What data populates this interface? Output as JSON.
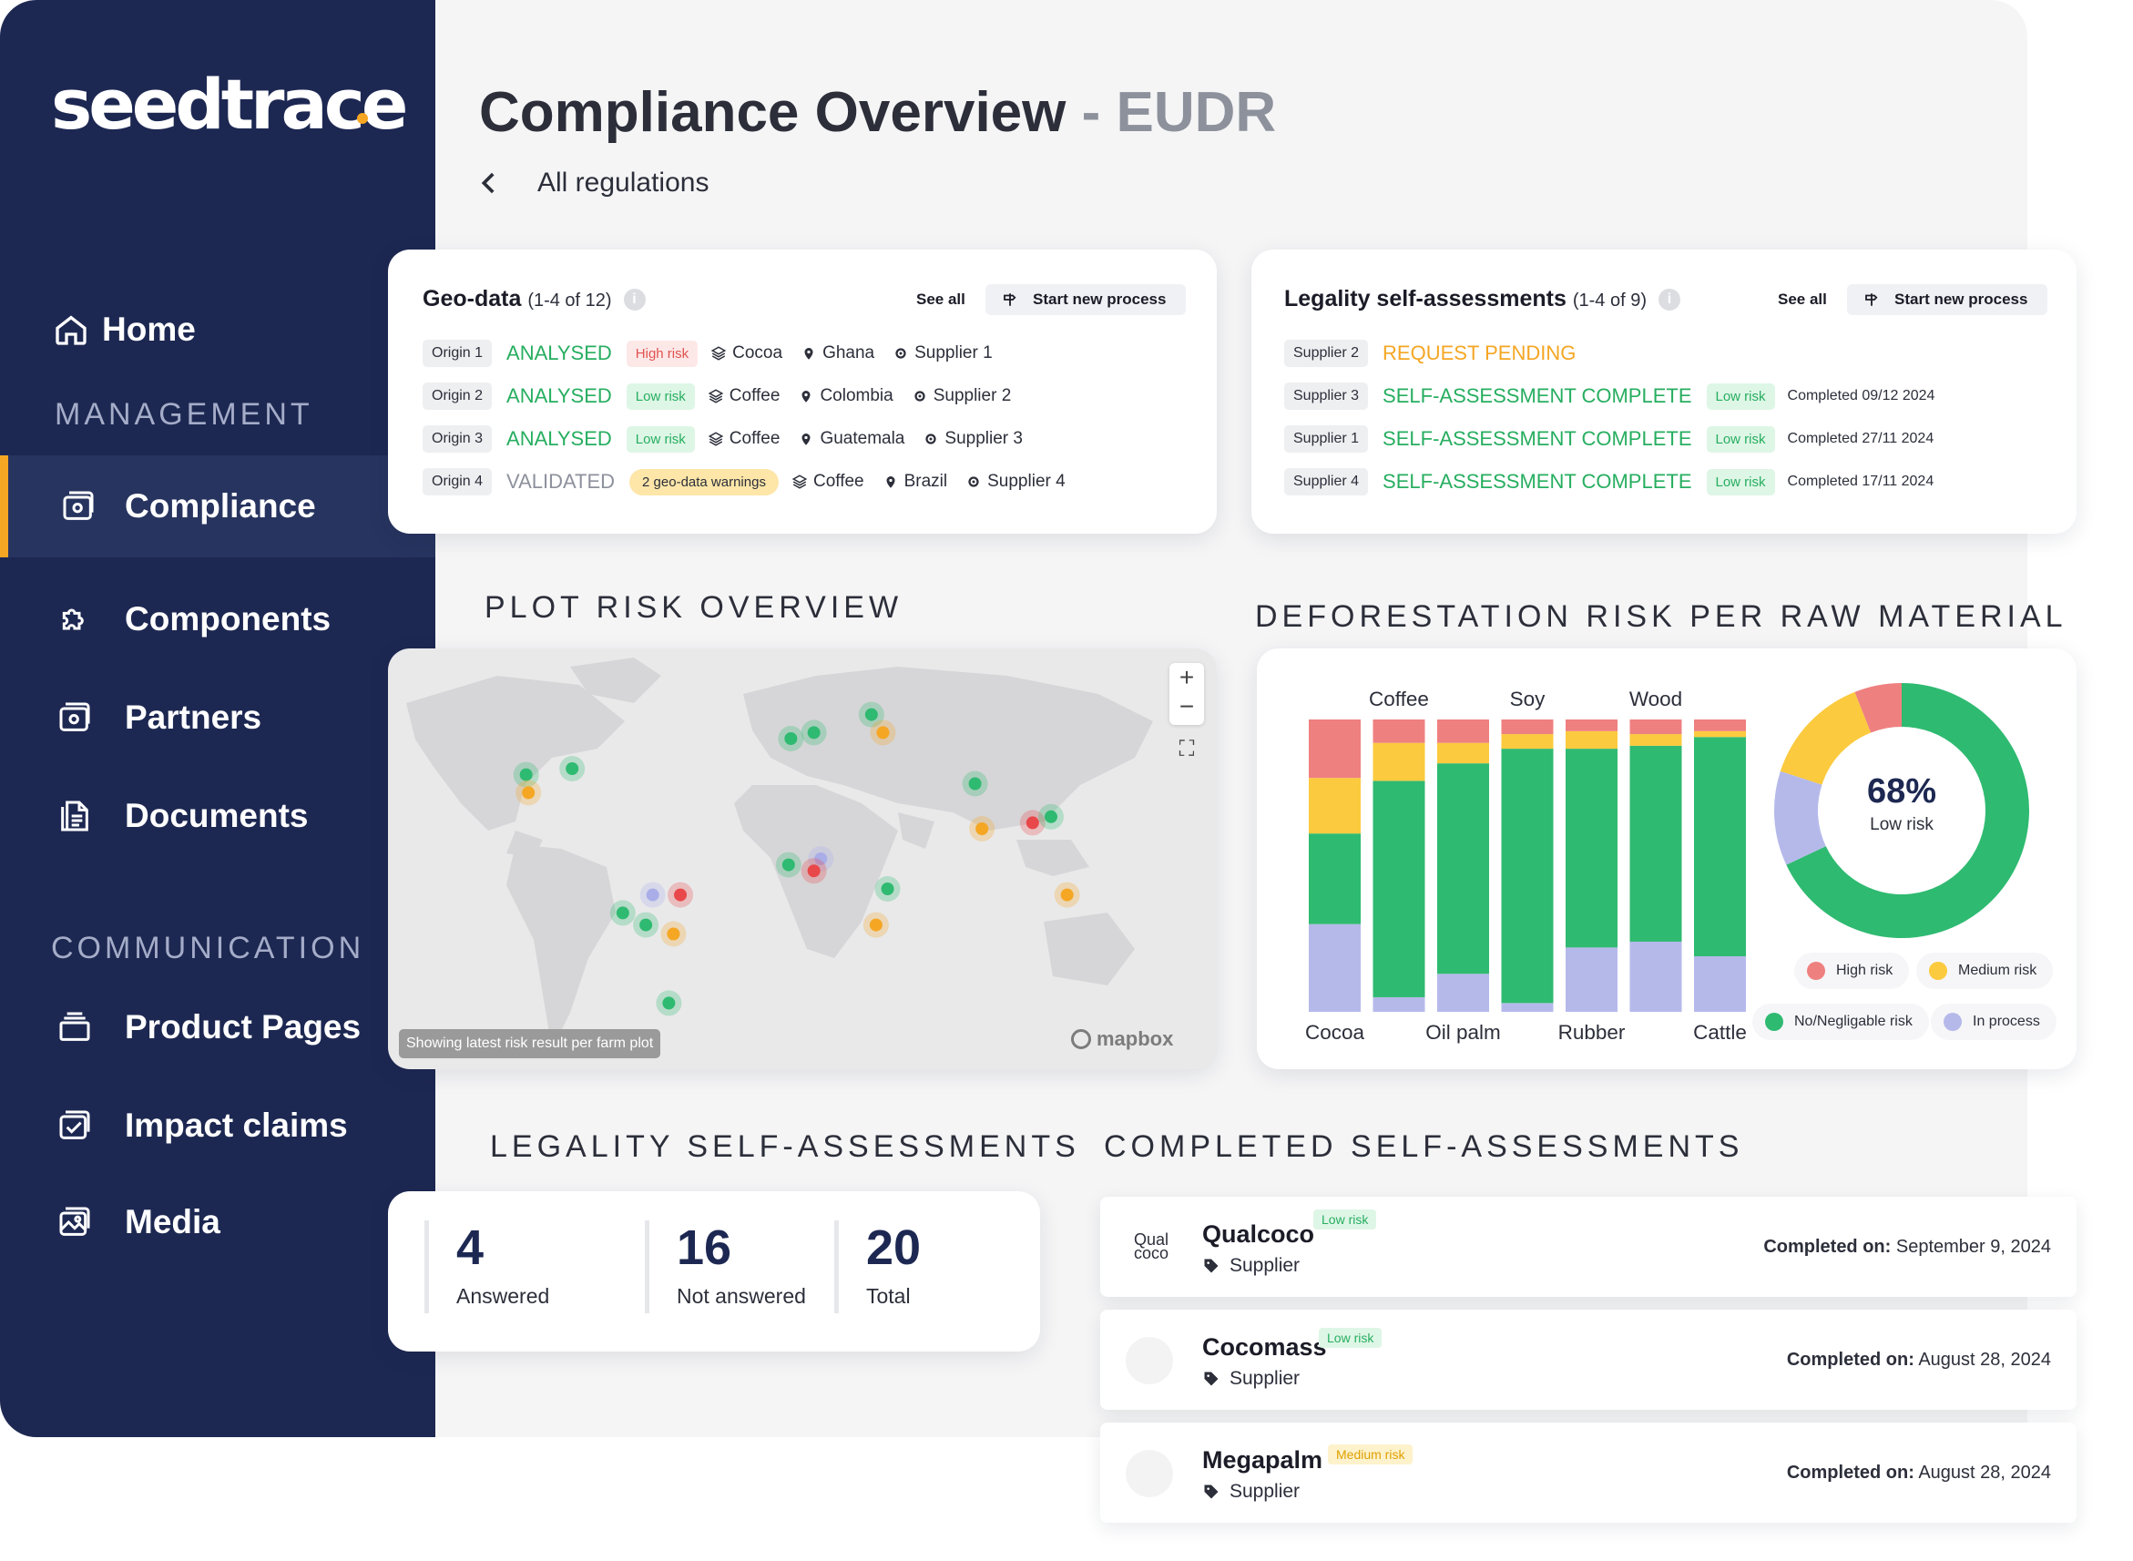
{
  "brand": {
    "logo_text": "seedtrace",
    "accent": "#f5a623",
    "sidebar_bg": "#1d2852"
  },
  "sidebar": {
    "home": "Home",
    "section_management": "MANAGEMENT",
    "items_management": [
      "Compliance",
      "Components",
      "Partners",
      "Documents"
    ],
    "section_communication": "COMMUNICATION",
    "items_communication": [
      "Product Pages",
      "Impact claims",
      "Media"
    ],
    "active": "Compliance"
  },
  "header": {
    "title": "Compliance Overview",
    "title_suffix": "- EUDR",
    "breadcrumb": "All regulations"
  },
  "geo_data": {
    "title": "Geo-data",
    "count": "(1-4 of 12)",
    "see_all": "See all",
    "start_button": "Start new process",
    "rows": [
      {
        "origin": "Origin 1",
        "status": "ANALYSED",
        "badge": "High risk",
        "commodity": "Cocoa",
        "country": "Ghana",
        "supplier": "Supplier 1"
      },
      {
        "origin": "Origin 2",
        "status": "ANALYSED",
        "badge": "Low risk",
        "commodity": "Coffee",
        "country": "Colombia",
        "supplier": "Supplier 2"
      },
      {
        "origin": "Origin 3",
        "status": "ANALYSED",
        "badge": "Low risk",
        "commodity": "Coffee",
        "country": "Guatemala",
        "supplier": "Supplier 3"
      },
      {
        "origin": "Origin 4",
        "status": "VALIDATED",
        "badge": "2 geo-data warnings",
        "commodity": "Coffee",
        "country": "Brazil",
        "supplier": "Supplier 4"
      }
    ]
  },
  "legality": {
    "title": "Legality self-assessments",
    "count": "(1-4 of 9)",
    "see_all": "See all",
    "start_button": "Start new process",
    "rows": [
      {
        "supplier": "Supplier 2",
        "status": "REQUEST PENDING",
        "badge": "",
        "completed": ""
      },
      {
        "supplier": "Supplier 3",
        "status": "SELF-ASSESSMENT COMPLETE",
        "badge": "Low risk",
        "completed": "Completed 09/12 2024"
      },
      {
        "supplier": "Supplier 1",
        "status": "SELF-ASSESSMENT COMPLETE",
        "badge": "Low risk",
        "completed": "Completed 27/11 2024"
      },
      {
        "supplier": "Supplier 4",
        "status": "SELF-ASSESSMENT COMPLETE",
        "badge": "Low risk",
        "completed": "Completed 17/11 2024"
      }
    ]
  },
  "plot_risk": {
    "label": "PLOT RISK OVERVIEW",
    "note": "Showing latest risk result per farm plot",
    "attribution": "mapbox",
    "zoom_in": "+",
    "zoom_out": "−",
    "fullscreen": "⛶"
  },
  "deforestation": {
    "label": "DEFORESTATION RISK PER RAW MATERIAL"
  },
  "chart_data": [
    {
      "type": "bar",
      "stacked": true,
      "categories": [
        "Cocoa",
        "Coffee",
        "Oil palm",
        "Soy",
        "Rubber",
        "Wood",
        "Cattle"
      ],
      "series": [
        {
          "name": "In process",
          "color": "#b5b9ea",
          "values": [
            30,
            5,
            13,
            3,
            22,
            24,
            19
          ]
        },
        {
          "name": "No/Negligable risk",
          "color": "#2fba71",
          "values": [
            31,
            74,
            72,
            87,
            68,
            67,
            75
          ]
        },
        {
          "name": "Medium risk",
          "color": "#fbca3e",
          "values": [
            19,
            13,
            7,
            5,
            6,
            4,
            2
          ]
        },
        {
          "name": "High risk",
          "color": "#ef8080",
          "values": [
            20,
            8,
            8,
            5,
            4,
            5,
            4
          ]
        }
      ],
      "ylim": [
        0,
        100
      ],
      "grid": false
    },
    {
      "type": "pie",
      "donut": true,
      "center_value": "68%",
      "center_label": "Low risk",
      "slices": [
        {
          "name": "No/Negligable risk",
          "value": 68,
          "color": "#2fba71"
        },
        {
          "name": "In process",
          "value": 12,
          "color": "#b5b9ea"
        },
        {
          "name": "Medium risk",
          "value": 14,
          "color": "#fbca3e"
        },
        {
          "name": "High risk",
          "value": 6,
          "color": "#ef8080"
        }
      ],
      "legend": [
        "High risk",
        "Medium risk",
        "No/Negligable risk",
        "In process"
      ]
    }
  ],
  "legality_stats": {
    "label": "LEGALITY SELF-ASSESSMENTS",
    "answered": "4",
    "answered_label": "Answered",
    "not_answered": "16",
    "not_answered_label": "Not answered",
    "total": "20",
    "total_label": "Total"
  },
  "completed": {
    "label": "COMPLETED SELF-ASSESSMENTS",
    "date_prefix": "Completed on:",
    "items": [
      {
        "name": "Qualcoco",
        "type": "Supplier",
        "badge": "Low risk",
        "date": "September 9, 2024",
        "logo_text": "Qual coco"
      },
      {
        "name": "Cocomass",
        "type": "Supplier",
        "badge": "Low risk",
        "date": "August 28, 2024",
        "logo_text": ""
      },
      {
        "name": "Megapalm",
        "type": "Supplier",
        "badge": "Medium risk",
        "date": "August 28, 2024",
        "logo_text": ""
      }
    ]
  },
  "map_markers": [
    {
      "lon": -120,
      "lat": 38,
      "risk": "low"
    },
    {
      "lon": -119,
      "lat": 32,
      "risk": "medium"
    },
    {
      "lon": -100,
      "lat": 40,
      "risk": "low"
    },
    {
      "lon": -5,
      "lat": 50,
      "risk": "low"
    },
    {
      "lon": 5,
      "lat": 52,
      "risk": "low"
    },
    {
      "lon": 30,
      "lat": 58,
      "risk": "low"
    },
    {
      "lon": 35,
      "lat": 52,
      "risk": "medium"
    },
    {
      "lon": 75,
      "lat": 35,
      "risk": "low"
    },
    {
      "lon": 78,
      "lat": 20,
      "risk": "medium"
    },
    {
      "lon": 100,
      "lat": 22,
      "risk": "high"
    },
    {
      "lon": 108,
      "lat": 24,
      "risk": "low"
    },
    {
      "lon": 115,
      "lat": -2,
      "risk": "medium"
    },
    {
      "lon": 8,
      "lat": 10,
      "risk": "in_process"
    },
    {
      "lon": -6,
      "lat": 8,
      "risk": "low"
    },
    {
      "lon": 5,
      "lat": 6,
      "risk": "high"
    },
    {
      "lon": 37,
      "lat": 0,
      "risk": "low"
    },
    {
      "lon": 32,
      "lat": -12,
      "risk": "medium"
    },
    {
      "lon": -65,
      "lat": -2,
      "risk": "in_process"
    },
    {
      "lon": -53,
      "lat": -2,
      "risk": "high"
    },
    {
      "lon": -78,
      "lat": -8,
      "risk": "low"
    },
    {
      "lon": -68,
      "lat": -12,
      "risk": "low"
    },
    {
      "lon": -56,
      "lat": -15,
      "risk": "medium"
    },
    {
      "lon": -58,
      "lat": -38,
      "risk": "low"
    }
  ]
}
